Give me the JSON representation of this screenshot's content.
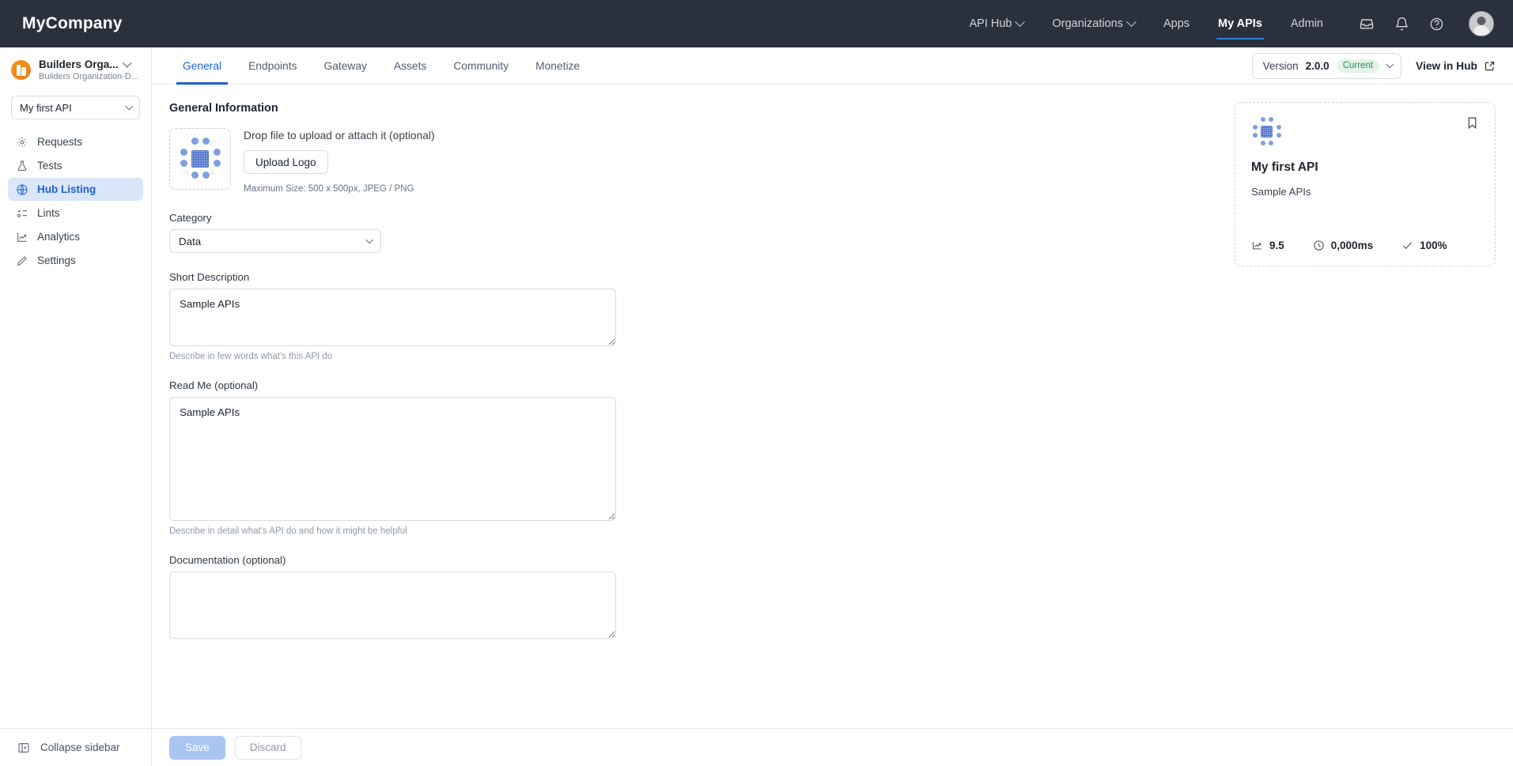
{
  "topbar": {
    "brand": "MyCompany",
    "nav": [
      {
        "label": "API Hub",
        "has_dropdown": true,
        "active": false
      },
      {
        "label": "Organizations",
        "has_dropdown": true,
        "active": false
      },
      {
        "label": "Apps",
        "has_dropdown": false,
        "active": false
      },
      {
        "label": "My APIs",
        "has_dropdown": false,
        "active": true
      },
      {
        "label": "Admin",
        "has_dropdown": false,
        "active": false
      }
    ],
    "icons": [
      "inbox-icon",
      "bell-icon",
      "help-circle-icon"
    ],
    "avatar": "user-avatar"
  },
  "sidebar": {
    "org_name": "Builders Orga...",
    "org_subtitle": "Builders Organization-D...",
    "api_selector": "My first API",
    "items": [
      {
        "label": "Requests",
        "icon": "requests-icon",
        "active": false
      },
      {
        "label": "Tests",
        "icon": "flask-icon",
        "active": false
      },
      {
        "label": "Hub Listing",
        "icon": "globe-icon",
        "active": true
      },
      {
        "label": "Lints",
        "icon": "lints-icon",
        "active": false
      },
      {
        "label": "Analytics",
        "icon": "analytics-icon",
        "active": false
      },
      {
        "label": "Settings",
        "icon": "pencil-icon",
        "active": false
      }
    ],
    "collapse_label": "Collapse sidebar",
    "active_color": "#1c63d5",
    "active_bg": "#dbe6fb"
  },
  "tabs": [
    {
      "label": "General",
      "active": true
    },
    {
      "label": "Endpoints",
      "active": false
    },
    {
      "label": "Gateway",
      "active": false
    },
    {
      "label": "Assets",
      "active": false
    },
    {
      "label": "Community",
      "active": false
    },
    {
      "label": "Monetize",
      "active": false
    }
  ],
  "version": {
    "prefix": "Version",
    "number": "2.0.0",
    "badge": "Current",
    "badge_color": "#2a8a54"
  },
  "view_in_hub": "View in Hub",
  "form": {
    "section_title": "General Information",
    "drop_text": "Drop file to upload or attach it (optional)",
    "upload_button": "Upload Logo",
    "max_size": "Maximum Size: 500 x 500px, JPEG / PNG",
    "category_label": "Category",
    "category_value": "Data",
    "short_description_label": "Short Description",
    "short_description_value": "Sample APIs",
    "short_description_helper": "Describe in few words what's this API do",
    "readme_label": "Read Me (optional)",
    "readme_value": "Sample APIs",
    "readme_helper": "Describe in detail what's API do and how it might be helpful",
    "documentation_label": "Documentation (optional)",
    "documentation_value": ""
  },
  "preview_card": {
    "title": "My first API",
    "subtitle": "Sample APIs",
    "stats": [
      {
        "icon": "trend-up-icon",
        "value": "9.5"
      },
      {
        "icon": "clock-icon",
        "value": "0,000ms"
      },
      {
        "icon": "check-icon",
        "value": "100%"
      }
    ],
    "bookmark_icon": "bookmark-icon"
  },
  "footer": {
    "save_label": "Save",
    "discard_label": "Discard"
  }
}
